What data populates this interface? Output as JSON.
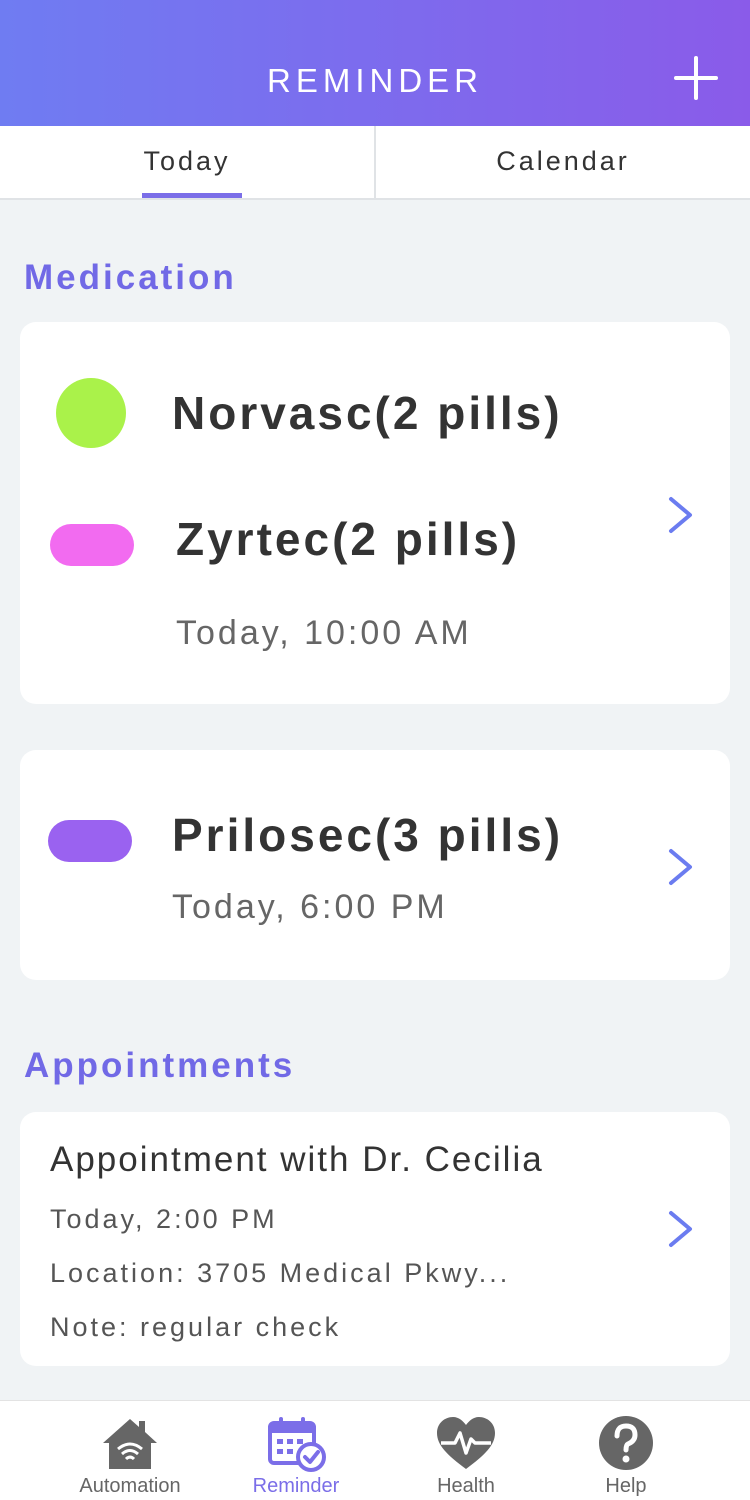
{
  "header": {
    "title": "REMINDER",
    "add_icon": "plus-icon"
  },
  "tabs": [
    {
      "label": "Today",
      "active": true
    },
    {
      "label": "Calendar",
      "active": false
    }
  ],
  "medication": {
    "section_title": "Medication",
    "cards": [
      {
        "items": [
          {
            "name": "Norvasc(2 pills)",
            "shape": "round-pill",
            "color": "#aaf24a"
          },
          {
            "name": "Zyrtec(2 pills)",
            "shape": "capsule",
            "color": "#f26bf0"
          }
        ],
        "time": "Today, 10:00 AM"
      },
      {
        "items": [
          {
            "name": "Prilosec(3 pills)",
            "shape": "capsule",
            "color": "#9a62f0"
          }
        ],
        "time": "Today, 6:00 PM"
      }
    ]
  },
  "appointments": {
    "section_title": "Appointments",
    "cards": [
      {
        "title": "Appointment with Dr. Cecilia",
        "time": "Today, 2:00 PM",
        "location": "Location: 3705 Medical Pkwy...",
        "note": "Note: regular check"
      }
    ]
  },
  "bottom_nav": [
    {
      "label": "Automation",
      "icon": "home-wifi-icon",
      "active": false
    },
    {
      "label": "Reminder",
      "icon": "calendar-check-icon",
      "active": true
    },
    {
      "label": "Health",
      "icon": "heart-pulse-icon",
      "active": false
    },
    {
      "label": "Help",
      "icon": "help-icon",
      "active": false
    }
  ],
  "colors": {
    "accent": "#7169e6",
    "chevron": "#6b7cf0",
    "header_gradient_start": "#6f7cf2",
    "header_gradient_end": "#8a5be9"
  }
}
